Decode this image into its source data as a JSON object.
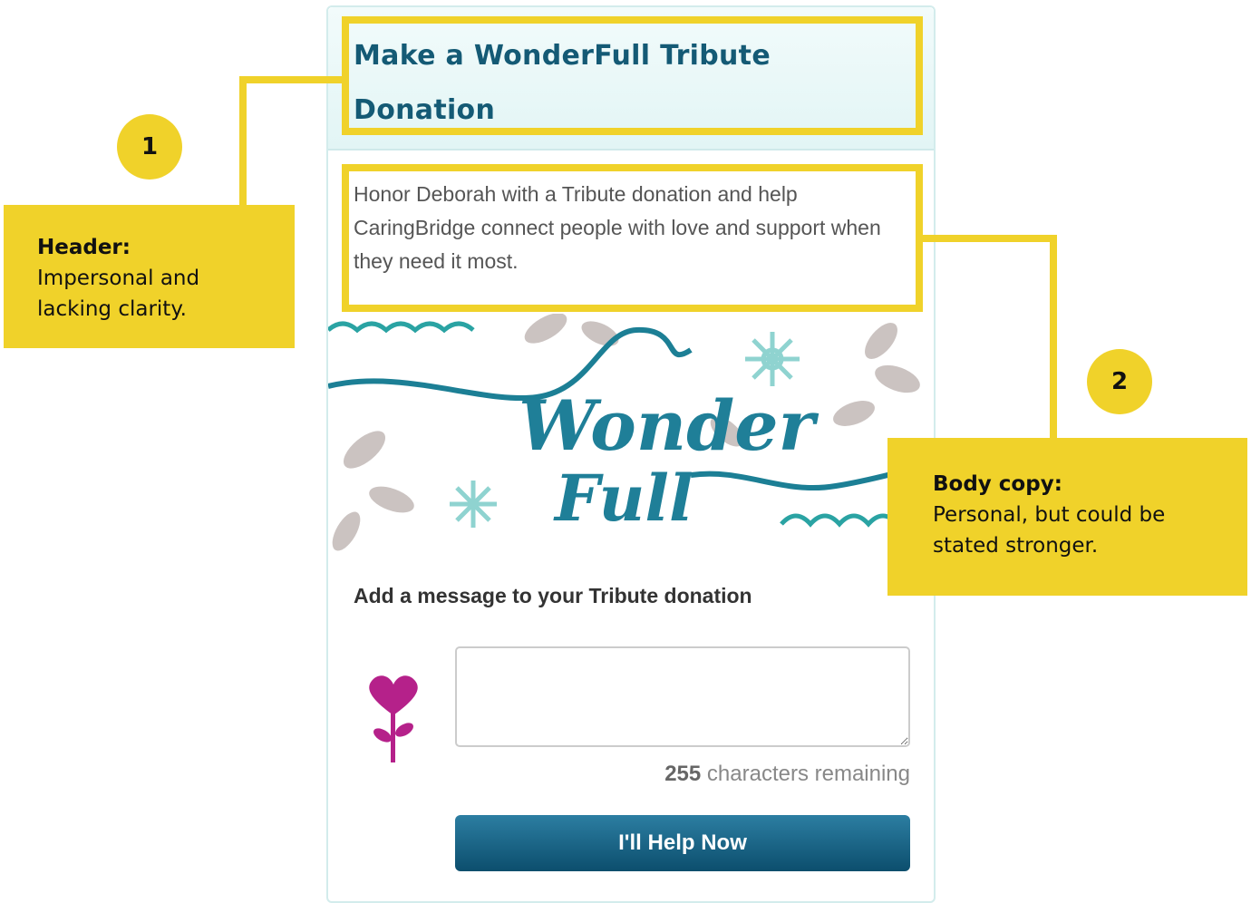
{
  "widget": {
    "title": "Make a WonderFull Tribute Donation",
    "body": "Honor Deborah with a Tribute donation and help CaringBridge connect people with love and support when they need it most.",
    "artwork_text": "Wonder Full",
    "message_label": "Add a message to your Tribute donation",
    "message_value": "",
    "chars_remaining": "255",
    "chars_remaining_suffix": " characters remaining",
    "button_label": "I'll Help Now",
    "icon": "heart-flower-icon"
  },
  "annotations": [
    {
      "number": "1",
      "title": "Header:",
      "description": "Impersonal and lacking clarity."
    },
    {
      "number": "2",
      "title": "Body copy:",
      "description": "Personal, but could be stated stronger."
    }
  ],
  "colors": {
    "highlight": "#f0d22a",
    "title": "#145a75",
    "button": "#0c4e6d",
    "heart": "#b5218a"
  }
}
